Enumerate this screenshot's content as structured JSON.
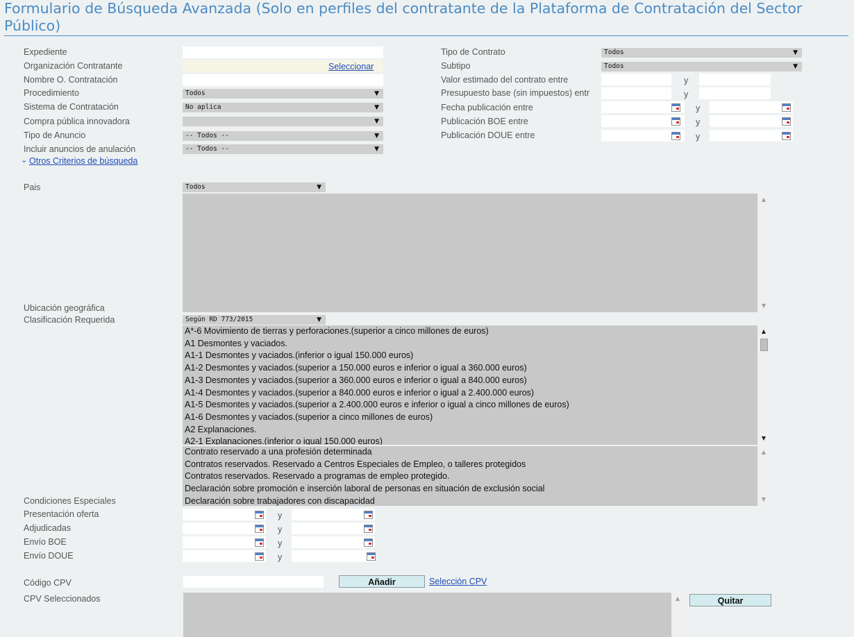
{
  "page": {
    "title": "Formulario de Búsqueda Avanzada (Solo en perfiles del contratante de la Plataforma de Contratación del Sector Público)"
  },
  "left": {
    "expediente_label": "Expediente",
    "organizacion_label": "Organización Contratante",
    "organizacion_link": "Seleccionar",
    "nombre_label": "Nombre O. Contratación",
    "procedimiento_label": "Procedimiento",
    "procedimiento_value": "Todos",
    "sistema_label": "Sistema de Contratación",
    "sistema_value": "No aplica",
    "compra_label": "Compra pública innovadora",
    "compra_value": "",
    "tipo_anuncio_label": "Tipo de Anuncio",
    "tipo_anuncio_value": "-- Todos --",
    "incluir_label": "Incluir anuncios de anulación",
    "incluir_value": "-- Todos --",
    "otros_link": "Otros Criterios de búsqueda"
  },
  "right": {
    "tipo_contrato_label": "Tipo de Contrato",
    "tipo_contrato_value": "Todos",
    "subtipo_label": "Subtipo",
    "subtipo_value": "Todos",
    "valor_label": "Valor estimado del contrato entre",
    "presupuesto_label": "Presupuesto base (sin impuestos) entr",
    "fecha_pub_label": "Fecha publicación entre",
    "boe_label": "Publicación BOE entre",
    "doue_label": "Publicación DOUE entre",
    "y": "y"
  },
  "otros": {
    "pais_label": "Pais",
    "pais_value": "Todos",
    "ubicacion_label": "Ubicación geográfica",
    "clasificacion_label": "Clasificación Requerida",
    "clasificacion_value": "Según RD 773/2015",
    "clasificacion_items": [
      "A*-6 Movimiento de tierras y perforaciones.(superior a cinco millones de euros)",
      "A1 Desmontes y vaciados.",
      "A1-1 Desmontes y vaciados.(inferior o igual 150.000 euros)",
      "A1-2 Desmontes y vaciados.(superior a 150.000 euros e inferior o igual a 360.000 euros)",
      "A1-3 Desmontes y vaciados.(superior a 360.000 euros e inferior o igual a 840.000 euros)",
      "A1-4 Desmontes y vaciados.(superior a 840.000 euros e inferior o igual a 2.400.000 euros)",
      "A1-5 Desmontes y vaciados.(superior a 2.400.000 euros e inferior o igual a cinco millones de euros)",
      "A1-6 Desmontes y vaciados.(superior a cinco millones de euros)",
      "A2 Explanaciones.",
      "A2-1 Explanaciones.(inferior o igual 150.000 euros)"
    ],
    "condiciones_label": "Condiciones Especiales",
    "condiciones_items": [
      "Contrato reservado a una profesión determinada",
      "Contratos reservados. Reservado a Centros Especiales de Empleo, o talleres protegidos",
      "Contratos reservados. Reservado a programas de empleo protegido.",
      "Declaración sobre promoción e inserción laboral de personas en situación de exclusión social",
      "Declaración sobre trabajadores con discapacidad"
    ],
    "presentacion_label": "Presentación oferta",
    "adjudicadas_label": "Adjudicadas",
    "envio_boe_label": "Envío BOE",
    "envio_doue_label": "Envío DOUE",
    "cpv_label": "Código CPV",
    "anadir_button": "Añadir",
    "seleccion_cpv_link": "Selección CPV",
    "cpv_sel_label": "CPV Seleccionados",
    "quitar_button": "Quitar"
  }
}
